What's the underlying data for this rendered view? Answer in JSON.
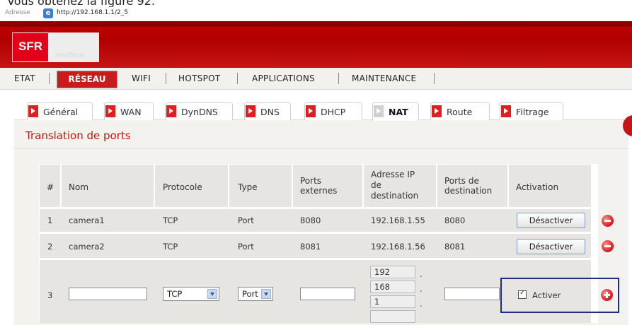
{
  "caption": "Vous obtenez la figure 92.",
  "browser": {
    "address_label": "Adresse",
    "url": "http://192.168.1.1/2_5"
  },
  "brand": {
    "logo": "SFR",
    "product": "neufbox"
  },
  "nav": {
    "items": [
      "ETAT",
      "RÉSEAU",
      "WIFI",
      "HOTSPOT",
      "APPLICATIONS",
      "MAINTENANCE"
    ],
    "active": "RÉSEAU"
  },
  "tabs": [
    "Général",
    "WAN",
    "DynDNS",
    "DNS",
    "DHCP",
    "NAT",
    "Route",
    "Filtrage"
  ],
  "active_tab": "NAT",
  "section": {
    "title": "Translation de ports"
  },
  "table": {
    "headers": {
      "num": "#",
      "nom": "Nom",
      "protocole": "Protocole",
      "type": "Type",
      "ports_externes": [
        "Ports",
        "externes"
      ],
      "adresse_ip": [
        "Adresse IP",
        "de",
        "destination"
      ],
      "ports_dest": [
        "Ports de",
        "destination"
      ],
      "activation": "Activation"
    },
    "rows": [
      {
        "num": "1",
        "nom": "camera1",
        "protocole": "TCP",
        "type": "Port",
        "ports_externes": "8080",
        "adresse_ip": "192.168.1.55",
        "ports_dest": "8080",
        "action": "Désactiver"
      },
      {
        "num": "2",
        "nom": "camera2",
        "protocole": "TCP",
        "type": "Port",
        "ports_externes": "8081",
        "adresse_ip": "192.168.1.56",
        "ports_dest": "8081",
        "action": "Désactiver"
      }
    ],
    "new_row": {
      "num": "3",
      "protocole_selected": "TCP",
      "type_selected": "Port",
      "ip_octets": [
        "192",
        "168",
        "1",
        ""
      ],
      "activer_label": "Activer",
      "activer_checked": true
    }
  },
  "colors": {
    "brand_red": "#c81414",
    "section_title": "#c8160f",
    "highlight_border": "#1d2c8c"
  },
  "icons": {
    "remove": "minus-circle-icon",
    "add": "plus-circle-icon",
    "tab_arrow": "arrow-right-icon"
  }
}
